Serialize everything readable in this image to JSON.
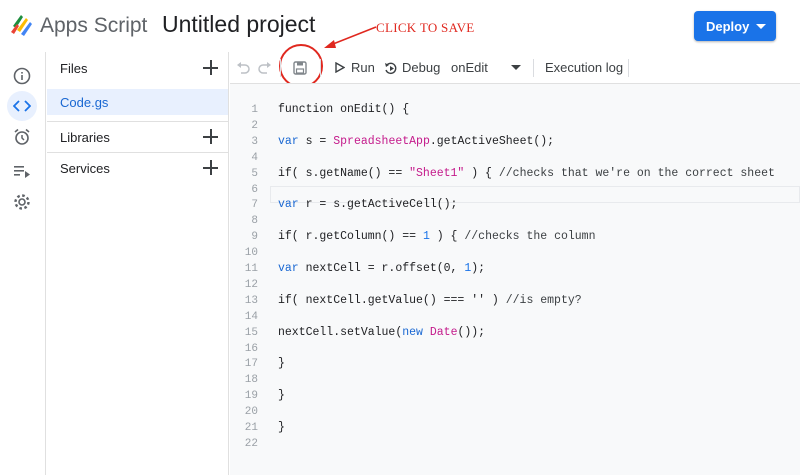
{
  "header": {
    "brand": "Apps Script",
    "project_title": "Untitled project",
    "deploy_label": "Deploy"
  },
  "annotation": {
    "text": "CLICK TO SAVE",
    "color": "#e0281f"
  },
  "rail": {
    "icons": [
      "info-icon",
      "code-icon",
      "alarm-icon",
      "executions-icon",
      "gear-icon"
    ],
    "active": "code-icon"
  },
  "files_panel": {
    "files_header": "Files",
    "file_item": "Code.gs",
    "libraries": "Libraries",
    "services": "Services"
  },
  "toolbar": {
    "run": "Run",
    "debug": "Debug",
    "function_select": "onEdit",
    "execution_log": "Execution log"
  },
  "code": {
    "lines": [
      {
        "n": "1",
        "text": "function onEdit() {"
      },
      {
        "n": "2",
        "text": ""
      },
      {
        "n": "3",
        "text": "var s = SpreadsheetApp.getActiveSheet();"
      },
      {
        "n": "4",
        "text": ""
      },
      {
        "n": "5",
        "text": "if( s.getName() == \"Sheet1\" ) { //checks that we're on the correct sheet"
      },
      {
        "n": "6",
        "text": ""
      },
      {
        "n": "7",
        "text": "var r = s.getActiveCell();"
      },
      {
        "n": "8",
        "text": ""
      },
      {
        "n": "9",
        "text": "if( r.getColumn() == 1 ) { //checks the column"
      },
      {
        "n": "10",
        "text": ""
      },
      {
        "n": "11",
        "text": "var nextCell = r.offset(0, 1);"
      },
      {
        "n": "12",
        "text": ""
      },
      {
        "n": "13",
        "text": "if( nextCell.getValue() === '' ) //is empty?"
      },
      {
        "n": "14",
        "text": ""
      },
      {
        "n": "15",
        "text": "nextCell.setValue(new Date());"
      },
      {
        "n": "16",
        "text": ""
      },
      {
        "n": "17",
        "text": "}"
      },
      {
        "n": "18",
        "text": ""
      },
      {
        "n": "19",
        "text": "}"
      },
      {
        "n": "20",
        "text": ""
      },
      {
        "n": "21",
        "text": "}"
      },
      {
        "n": "22",
        "text": ""
      }
    ]
  },
  "colors": {
    "accent": "#1a73e8",
    "keyword": "#1967d2",
    "string_class": "#c41a8b",
    "number": "#1a73e8"
  }
}
